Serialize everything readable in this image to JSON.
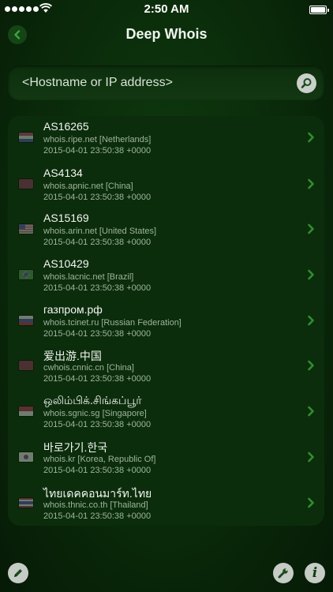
{
  "status_bar": {
    "time": "2:50 AM"
  },
  "nav": {
    "title": "Deep Whois",
    "back_icon": "chevron-left-icon"
  },
  "search": {
    "placeholder": "<Hostname or IP address>",
    "icon": "magnifier-icon"
  },
  "colors": {
    "accent_green": "#2f8f2f",
    "background": "#0a2a0a"
  },
  "results": [
    {
      "title": "AS16265",
      "server": "whois.ripe.net [Netherlands]",
      "date": "2015-04-01 23:50:38 +0000",
      "flag": "netherlands-flag-icon"
    },
    {
      "title": "AS4134",
      "server": "whois.apnic.net [China]",
      "date": "2015-04-01 23:50:38 +0000",
      "flag": "china-flag-icon"
    },
    {
      "title": "AS15169",
      "server": "whois.arin.net [United States]",
      "date": "2015-04-01 23:50:38 +0000",
      "flag": "usa-flag-icon"
    },
    {
      "title": "AS10429",
      "server": "whois.lacnic.net [Brazil]",
      "date": "2015-04-01 23:50:38 +0000",
      "flag": "brazil-flag-icon"
    },
    {
      "title": "газпром.рф",
      "server": "whois.tcinet.ru [Russian Federation]",
      "date": "2015-04-01 23:50:38 +0000",
      "flag": "russia-flag-icon"
    },
    {
      "title": "爱出游.中国",
      "server": "cwhois.cnnic.cn [China]",
      "date": "2015-04-01 23:50:38 +0000",
      "flag": "china-flag-icon"
    },
    {
      "title": "ஒலிம்பிக்.சிங்கப்பூர்",
      "server": "whois.sgnic.sg [Singapore]",
      "date": "2015-04-01 23:50:38 +0000",
      "flag": "singapore-flag-icon"
    },
    {
      "title": "바로가기.한국",
      "server": "whois.kr [Korea, Republic Of]",
      "date": "2015-04-01 23:50:38 +0000",
      "flag": "korea-flag-icon"
    },
    {
      "title": "ไทยเดคคอนมาร์ท.ไทย",
      "server": "whois.thnic.co.th [Thailand]",
      "date": "2015-04-01 23:50:38 +0000",
      "flag": "thailand-flag-icon"
    }
  ],
  "toolbar": {
    "edit_icon": "pencil-icon",
    "tools_icon": "wrench-icon",
    "info_icon": "info-icon",
    "info_label": "i"
  }
}
